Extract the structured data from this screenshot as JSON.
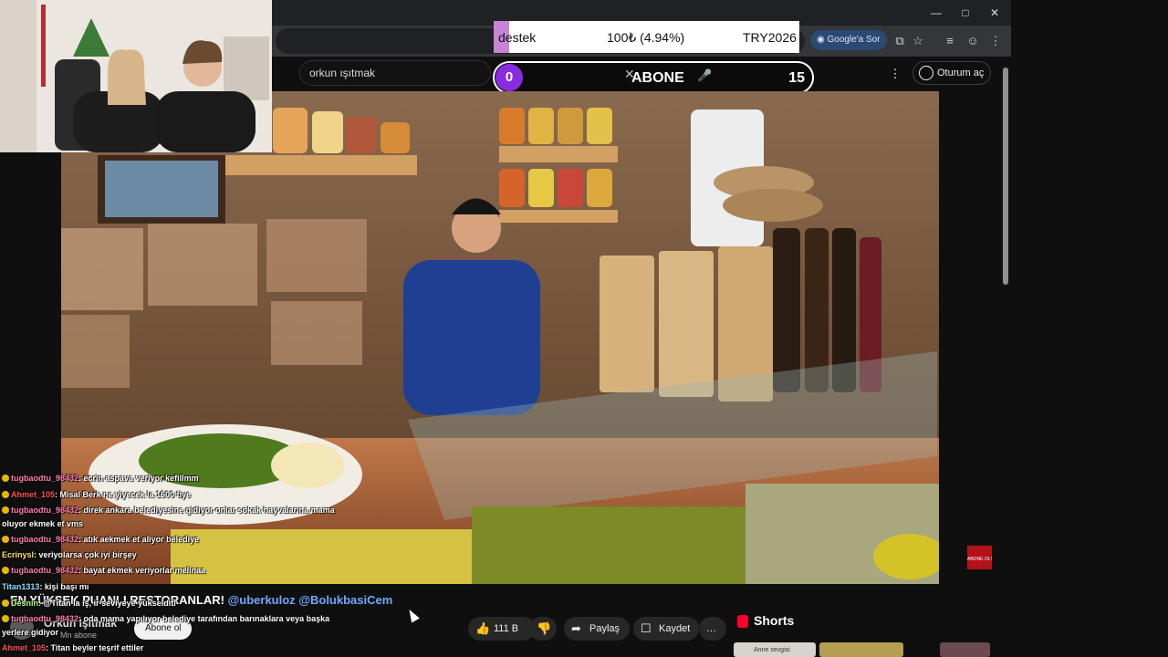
{
  "browser": {
    "google_sor": "Google'a Sor"
  },
  "donation": {
    "label": "destek",
    "amount": "100₺ (4.94%)",
    "code": "TRY2026",
    "progress_percent": 4.94
  },
  "youtube": {
    "search_value": "orkun ışıtmak",
    "signin_label": "Oturum aç"
  },
  "subgoal": {
    "current": "0",
    "label": "ABONE",
    "goal": "15"
  },
  "video_overlay": {
    "corner_badge": "ABONE OL!"
  },
  "mention": {
    "text": "EN YÜKSEK PUANLI RESTORANLAR!",
    "tag1": "@uberkuloz",
    "tag2": "@BolukbasiCem"
  },
  "channel": {
    "name": "Orkun Işıtmak",
    "subs": "Mn abone",
    "subscribe": "Abone ol"
  },
  "actions": {
    "likes": "111 B",
    "share": "Paylaş",
    "save": "Kaydet"
  },
  "shorts": {
    "title": "Shorts",
    "thumb1_caption": "Anne sevgisi"
  },
  "chat": [
    {
      "user": "tugbaodtu_98432",
      "text": ": ecrin aspava veriyor kefillmm"
    },
    {
      "user": "Ahmet_105",
      "text": ": Misal Berk ne yiyecek la 1600 tiye"
    },
    {
      "user": "tugbaodtu_98432",
      "text": ": direk ankara belediyesine gidiyor onlar sokak hayvalarına mama"
    },
    {
      "user": "",
      "text": "oluyor ekmek et vms"
    },
    {
      "user": "tugbaodtu_98432",
      "text": ": atık aekmek et aliyor belediye"
    },
    {
      "user": "Ecrinysl",
      "text": ": veriyolarsa çok iyi birşey"
    },
    {
      "user": "tugbaodtu_98432",
      "text": ": bayat ekmek veriyorlar melinaa"
    },
    {
      "user": "Titan1313",
      "text": ": kişi başı mı"
    },
    {
      "user": "Desnin",
      "text": ": @Titan la iş, ir seviyeye yükselditi"
    },
    {
      "user": "tugbaodtu_98432",
      "text": ": oda mama yapılıyor belediye tarafından barınaklara veya başka"
    },
    {
      "user": "",
      "text": "yerlere gidiyor"
    },
    {
      "user": "Ahmet_105",
      "text": ": Titan beyler teşrif ettiler"
    }
  ]
}
